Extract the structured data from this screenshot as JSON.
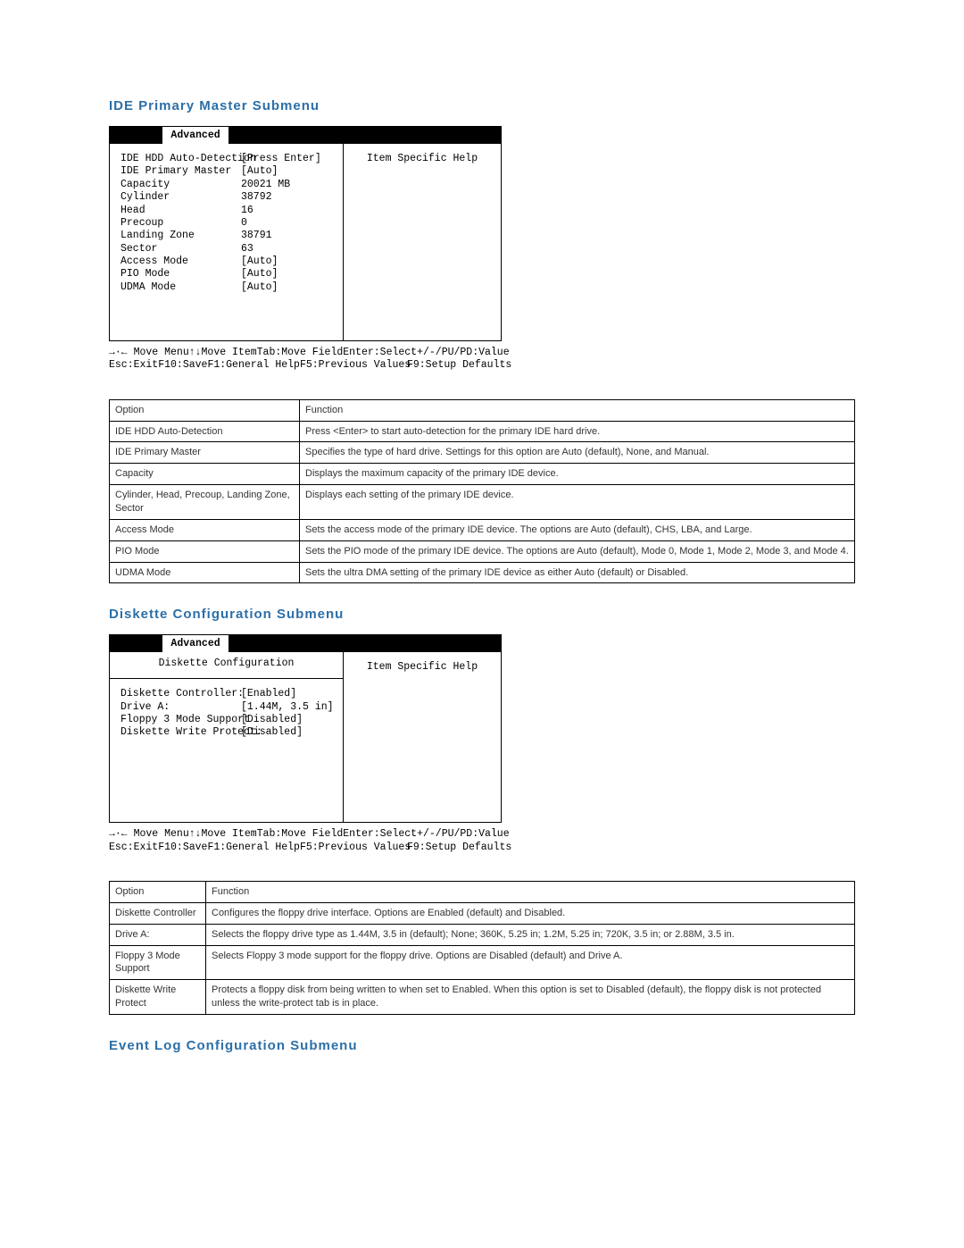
{
  "sections": {
    "ide": {
      "title": "IDE Primary Master Submenu",
      "bios": {
        "menubar": [
          "      ",
          "Advanced",
          "                        "
        ],
        "help_title": "Item Specific Help",
        "rows": [
          {
            "label": "IDE HDD Auto-Detection",
            "value": "[Press Enter]"
          },
          {
            "label": "",
            "value": ""
          },
          {
            "label": "IDE Primary Master",
            "value": "[Auto]"
          },
          {
            "label": "",
            "value": ""
          },
          {
            "label": "Capacity",
            "value": "20021 MB"
          },
          {
            "label": "",
            "value": ""
          },
          {
            "label": "Cylinder",
            "value": "38792"
          },
          {
            "label": "Head",
            "value": "16"
          },
          {
            "label": "Precoup",
            "value": "0"
          },
          {
            "label": "Landing Zone",
            "value": "38791"
          },
          {
            "label": "Sector",
            "value": "63"
          },
          {
            "label": "Access Mode",
            "value": "[Auto]"
          },
          {
            "label": "PIO Mode",
            "value": "[Auto]"
          },
          {
            "label": "UDMA Mode",
            "value": "[Auto]"
          }
        ],
        "footer": [
          [
            "→·← Move Menu",
            "↑↓Move Item",
            "Tab:Move Field",
            "Enter:Select",
            "+/-/PU/PD:Value"
          ],
          [
            "Esc:Exit",
            "F10:Save",
            "F1:General Help",
            "F5:Previous Values",
            "F9:Setup Defaults"
          ]
        ]
      },
      "options": {
        "headers": [
          "Option",
          "Function"
        ],
        "rows": [
          [
            "IDE HDD Auto-Detection",
            "Press <Enter> to start auto-detection for the primary IDE hard drive."
          ],
          [
            "IDE Primary Master",
            "Specifies the type of hard drive. Settings for this option are Auto (default), None, and Manual."
          ],
          [
            "Capacity",
            "Displays the maximum capacity of the primary IDE device."
          ],
          [
            "Cylinder, Head, Precoup, Landing Zone, Sector",
            "Displays each setting of the primary IDE device."
          ],
          [
            "Access Mode",
            "Sets the access mode of the primary IDE device. The options are Auto (default), CHS, LBA, and Large."
          ],
          [
            "PIO Mode",
            "Sets the PIO mode of the primary IDE device. The options are Auto (default), Mode 0, Mode 1, Mode 2, Mode 3, and Mode 4."
          ],
          [
            "UDMA Mode",
            "Sets the ultra DMA setting of the primary IDE device as either Auto (default) or Disabled."
          ]
        ]
      }
    },
    "diskette": {
      "title": "Diskette Configuration Submenu",
      "bios": {
        "menubar": [
          "      ",
          "Advanced",
          "                        "
        ],
        "subtitle": "Diskette Configuration",
        "help_title": "Item Specific Help",
        "rows": [
          {
            "label": "Diskette Controller:",
            "value": "[Enabled]"
          },
          {
            "label": "",
            "value": ""
          },
          {
            "label": "Drive A:",
            "value": "[1.44M, 3.5 in]"
          },
          {
            "label": "Floppy 3 Mode Support",
            "value": "[Disabled]"
          },
          {
            "label": "Diskette Write Protect:",
            "value": "[Disabled]"
          }
        ],
        "footer": [
          [
            "→·← Move Menu",
            "↑↓Move Item",
            "Tab:Move Field",
            "Enter:Select",
            "+/-/PU/PD:Value"
          ],
          [
            "Esc:Exit",
            "F10:Save",
            "F1:General Help",
            "F5:Previous Values",
            "F9:Setup Defaults"
          ]
        ]
      },
      "options": {
        "headers": [
          "Option",
          "Function"
        ],
        "rows": [
          [
            "Diskette Controller",
            "Configures the floppy drive interface. Options are Enabled (default) and Disabled."
          ],
          [
            "Drive A:",
            "Selects the floppy drive type as 1.44M, 3.5 in (default); None; 360K, 5.25 in; 1.2M, 5.25 in; 720K, 3.5 in; or 2.88M, 3.5 in."
          ],
          [
            "Floppy 3 Mode Support",
            "Selects Floppy 3 mode support for the floppy drive. Options are Disabled (default) and Drive A."
          ],
          [
            "Diskette Write Protect",
            "Protects a floppy disk from being written to when set to Enabled. When this option is set to Disabled (default), the floppy disk is not protected unless the write-protect tab is in place."
          ]
        ]
      }
    },
    "eventlog": {
      "title": "Event Log Configuration Submenu"
    }
  }
}
